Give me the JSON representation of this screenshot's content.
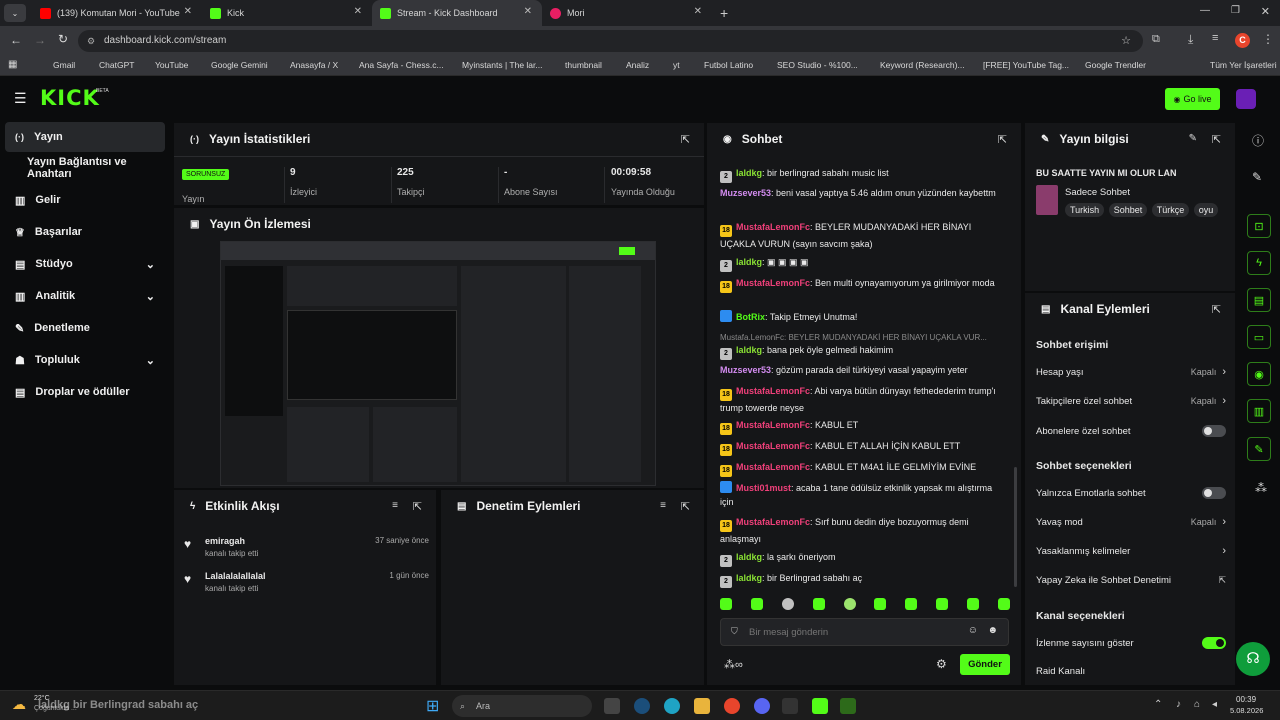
{
  "browser": {
    "tabs": [
      {
        "label": "(139) Komutan Mori - YouTube",
        "fav_color": "#ff0000"
      },
      {
        "label": "Kick",
        "fav_color": "#53fc18"
      },
      {
        "label": "Stream - Kick Dashboard",
        "fav_color": "#53fc18"
      },
      {
        "label": "Mori",
        "fav_color": "#e91e63"
      }
    ],
    "url": "dashboard.kick.com/stream",
    "profile_initial": "C",
    "bookmarks": [
      "Gmail",
      "ChatGPT",
      "YouTube",
      "Google Gemini",
      "Anasayfa / X",
      "Ana Sayfa - Chess.c...",
      "Myinstants | The lar...",
      "thumbnail",
      "Analiz",
      "yt",
      "Futbol Latino",
      "SEO Studio - %100...",
      "Keyword (Research)...",
      "[FREE] YouTube Tag...",
      "Google Trendler",
      "Tüm Yer İşaretleri"
    ]
  },
  "kick": {
    "logo": "KICK",
    "beta": "BETA",
    "go_live": "Go live",
    "accent": "#53fc18"
  },
  "sidebar": {
    "items": [
      {
        "label": "Yayın",
        "active": true
      },
      {
        "label": "Yayın Bağlantısı ve Anahtarı"
      },
      {
        "label": "Gelir"
      },
      {
        "label": "Başarılar"
      },
      {
        "label": "Stüdyo",
        "chevron": true
      },
      {
        "label": "Analitik",
        "chevron": true
      },
      {
        "label": "Denetleme"
      },
      {
        "label": "Topluluk",
        "chevron": true
      },
      {
        "label": "Droplar ve ödüller"
      }
    ]
  },
  "stats": {
    "title": "Yayın İstatistikleri",
    "status_badge": "SORUNSUZ",
    "status_label": "Yayın",
    "items": [
      {
        "value": "9",
        "label": "İzleyici"
      },
      {
        "value": "225",
        "label": "Takipçi"
      },
      {
        "value": "-",
        "label": "Abone Sayısı"
      },
      {
        "value": "00:09:58",
        "label": "Yayında Olduğu"
      }
    ]
  },
  "preview": {
    "title": "Yayın Ön İzlemesi"
  },
  "activity": {
    "title": "Etkinlik Akışı",
    "items": [
      {
        "name": "emiragah",
        "desc": "kanalı takip etti",
        "time": "37 saniye önce"
      },
      {
        "name": "Lalalalalallalal",
        "desc": "kanalı takip etti",
        "time": "1 gün önce"
      }
    ]
  },
  "moderation": {
    "title": "Denetim Eylemleri"
  },
  "chat": {
    "title": "Sohbet",
    "messages": [
      {
        "badge": "2",
        "user": "laldkg",
        "user_color": "#8ae234",
        "text": "bir berlingrad sabahı music list"
      },
      {
        "badge": "",
        "user": "Muzsever53",
        "user_color": "#d38cf0",
        "text": "beni vasal yaptıya 5.46 aldım onun yüzünden kaybettm"
      },
      {
        "badge": "18",
        "user": "MustafaLemonFc",
        "user_color": "#f0407a",
        "text": "BEYLER MUDANYADAKİ HER BİNAYI UÇAKLA VURUN (sayın savcım şaka)"
      },
      {
        "badge": "2",
        "user": "laldkg",
        "user_color": "#8ae234",
        "text": "▣ ▣ ▣ ▣"
      },
      {
        "badge": "18",
        "user": "MustafaLemonFc",
        "user_color": "#f0407a",
        "text": "Ben multi oynayamıyorum ya girilmiyor moda"
      },
      {
        "badge": "bot",
        "user": "BotRix",
        "user_color": "#53fc18",
        "text": "Takip Etmeyi Unutma!"
      },
      {
        "reply": "Mustafa.LemonFc: BEYLER MUDANYADAKİ HER BİNAYI UÇAKLA VUR..."
      },
      {
        "badge": "2",
        "user": "laldkg",
        "user_color": "#8ae234",
        "text": "bana pek öyle gelmedi hakimim"
      },
      {
        "badge": "",
        "user": "Muzsever53",
        "user_color": "#d38cf0",
        "text": "gözüm parada deil türkiyeyi vasal yapayim yeter"
      },
      {
        "badge": "18",
        "user": "MustafaLemonFc",
        "user_color": "#f0407a",
        "text": "Abi varya bütün dünyayı fethedederim trump'ı trump towerde neyse"
      },
      {
        "badge": "18",
        "user": "MustafaLemonFc",
        "user_color": "#f0407a",
        "text": "KABUL ET"
      },
      {
        "badge": "18",
        "user": "MustafaLemonFc",
        "user_color": "#f0407a",
        "text": "KABUL ET ALLAH İÇİN KABUL ETT"
      },
      {
        "badge": "18",
        "user": "MustafaLemonFc",
        "user_color": "#f0407a",
        "text": "KABUL ET M4A1 İLE GELMİYİM EVİNE"
      },
      {
        "badge": "x",
        "user": "Musti01must",
        "user_color": "#f0407a",
        "text": "acaba 1 tane ödülsüz etkinlik yapsak mı alıştırma için"
      },
      {
        "badge": "18",
        "user": "MustafaLemonFc",
        "user_color": "#f0407a",
        "text": "Sırf bunu dedin diye bozuyormuş demi anlaşmayı"
      },
      {
        "badge": "2",
        "user": "laldkg",
        "user_color": "#8ae234",
        "text": "la şarkı öneriyom"
      },
      {
        "badge": "2",
        "user": "laldkg",
        "user_color": "#8ae234",
        "text": "bir Berlingrad sabahı aç"
      }
    ],
    "input_placeholder": "Bir mesaj gönderin",
    "send_label": "Gönder"
  },
  "stream_info": {
    "title": "Yayın bilgisi",
    "stream_title": "BU SAATTE YAYIN MI OLUR LAN",
    "category": "Sadece Sohbet",
    "tags": [
      "Turkish",
      "Sohbet",
      "Türkçe",
      "oyu"
    ]
  },
  "channel_actions": {
    "title": "Kanal Eylemleri",
    "chat_access_heading": "Sohbet erişimi",
    "rows_access": [
      {
        "label": "Hesap yaşı",
        "value": "Kapalı",
        "type": "chevron"
      },
      {
        "label": "Takipçilere özel sohbet",
        "value": "Kapalı",
        "type": "chevron"
      },
      {
        "label": "Abonelere özel sohbet",
        "type": "toggle",
        "on": false
      }
    ],
    "chat_options_heading": "Sohbet seçenekleri",
    "rows_options": [
      {
        "label": "Yalnızca Emotlarla sohbet",
        "type": "toggle",
        "on": false
      },
      {
        "label": "Yavaş mod",
        "value": "Kapalı",
        "type": "chevron"
      },
      {
        "label": "Yasaklanmış kelimeler",
        "value": "",
        "type": "chevron"
      },
      {
        "label": "Yapay Zeka ile Sohbet Denetimi",
        "value": "",
        "type": "external"
      }
    ],
    "channel_options_heading": "Kanal seçenekleri",
    "rows_channel": [
      {
        "label": "İzlenme sayısını göster",
        "type": "toggle",
        "on": true
      },
      {
        "label": "Raid Kanalı",
        "type": "none"
      }
    ]
  },
  "taskbar": {
    "weather_temp": "22°C",
    "weather_desc": "Çoğunlukla ...",
    "overlay_text": "laldkg  bir Berlingrad sabahı aç",
    "search_placeholder": "Ara",
    "time": "00:39",
    "date": "5.08.2026"
  }
}
